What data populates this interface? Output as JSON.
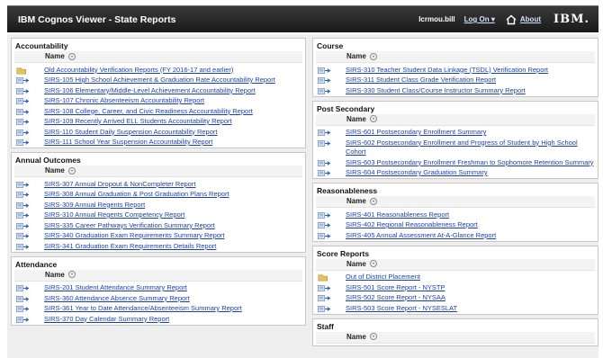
{
  "header": {
    "title": "IBM Cognos Viewer - State Reports",
    "user": "lcrmou.bill",
    "logon_label": "Log On ▾",
    "about_label": "About",
    "logo_text": "IBM."
  },
  "colors": {
    "link": "#1a3fb0",
    "header_bg": "#222222",
    "panel_bg": "#ffffff",
    "content_bg": "#eeeeee"
  },
  "left_panels": [
    {
      "title": "Accountability",
      "header": "Name",
      "items": [
        {
          "icon": "folder-icon",
          "label": "Old Accountability Verification Reports (FY 2016-17 and earlier)"
        },
        {
          "icon": "report-icon",
          "label": "SIRS-105 High School Achievement & Graduation Rate Accountability Report"
        },
        {
          "icon": "report-icon",
          "label": "SIRS-106 Elementary/Middle-Level Achievement Accountability Report"
        },
        {
          "icon": "report-icon",
          "label": "SIRS-107 Chronic Absenteeism Accountability Report"
        },
        {
          "icon": "report-icon",
          "label": "SIRS-108 College, Career, and Civic Readiness Accountability Report"
        },
        {
          "icon": "report-icon",
          "label": "SIRS-109 Recently Arrived ELL Students Accountability Report"
        },
        {
          "icon": "report-icon",
          "label": "SIRS-110 Student Daily Suspension Accountability Report"
        },
        {
          "icon": "report-icon",
          "label": "SIRS-111 School Year Suspension Accountability Report"
        }
      ]
    },
    {
      "title": "Annual Outcomes",
      "header": "Name",
      "items": [
        {
          "icon": "report-icon",
          "label": "SIRS-307 Annual Dropout & NonCompleter Report"
        },
        {
          "icon": "report-icon",
          "label": "SIRS-308 Annual Graduation & Post Graduation Plans Report"
        },
        {
          "icon": "report-icon",
          "label": "SIRS-309 Annual Regents Report"
        },
        {
          "icon": "report-icon",
          "label": "SIRS-310 Annual Regents Competency Report"
        },
        {
          "icon": "report-icon",
          "label": "SIRS-335 Career Pathways Verification Summary Report"
        },
        {
          "icon": "report-icon",
          "label": "SIRS-340 Graduation Exam Requirements Summary Report"
        },
        {
          "icon": "report-icon",
          "label": "SIRS-341 Graduation Exam Requirements Details Report"
        }
      ]
    },
    {
      "title": "Attendance",
      "header": "Name",
      "items": [
        {
          "icon": "report-icon",
          "label": "SIRS-201 Student Attendance Summary Report"
        },
        {
          "icon": "report-icon",
          "label": "SIRS-360 Attendance Absence Summary Report"
        },
        {
          "icon": "report-icon",
          "label": "SIRS-361 Year to Date Attendance/Absenteeism Summary Report"
        },
        {
          "icon": "report-icon",
          "label": "SIRS-370 Day Calendar Summary Report"
        }
      ]
    }
  ],
  "right_panels": [
    {
      "title": "Course",
      "header": "Name",
      "items": [
        {
          "icon": "report-icon",
          "label": "SIRS-310 Teacher Student Data Linkage (TSDL) Verification Report"
        },
        {
          "icon": "report-icon",
          "label": "SIRS-311 Student Class Grade Verification Report"
        },
        {
          "icon": "report-icon",
          "label": "SIRS-330 Student Class/Course Instructor Summary Report"
        }
      ]
    },
    {
      "title": "Post Secondary",
      "header": "Name",
      "items": [
        {
          "icon": "report-icon",
          "label": "SIRS-601 Postsecondary Enrollment Summary"
        },
        {
          "icon": "report-icon",
          "label": "SIRS-602 Postsecondary Enrollment and Progress of Student by High School Cohort"
        },
        {
          "icon": "report-icon",
          "label": "SIRS-603 Postsecondary Enrollment Freshman to Sophomore Retention Summary"
        },
        {
          "icon": "report-icon",
          "label": "SIRS-604 Postsecondary Graduation Summary"
        }
      ]
    },
    {
      "title": "Reasonableness",
      "header": "Name",
      "items": [
        {
          "icon": "report-icon",
          "label": "SIRS-401 Reasonableness Report"
        },
        {
          "icon": "report-icon",
          "label": "SIRS-402 Regional Reasonableness Report"
        },
        {
          "icon": "report-icon",
          "label": "SIRS-405 Annual Assessment At-A-Glance Report"
        }
      ]
    },
    {
      "title": "Score Reports",
      "header": "Name",
      "items": [
        {
          "icon": "folder-icon",
          "label": "Out of District Placement"
        },
        {
          "icon": "report-icon",
          "label": "SIRS-501 Score Report - NYSTP"
        },
        {
          "icon": "report-icon",
          "label": "SIRS-502 Score Report - NYSAA"
        },
        {
          "icon": "report-icon",
          "label": "SIRS-503 Score Report - NYSESLAT"
        }
      ]
    },
    {
      "title": "Staff",
      "header": "Name",
      "items": []
    }
  ]
}
